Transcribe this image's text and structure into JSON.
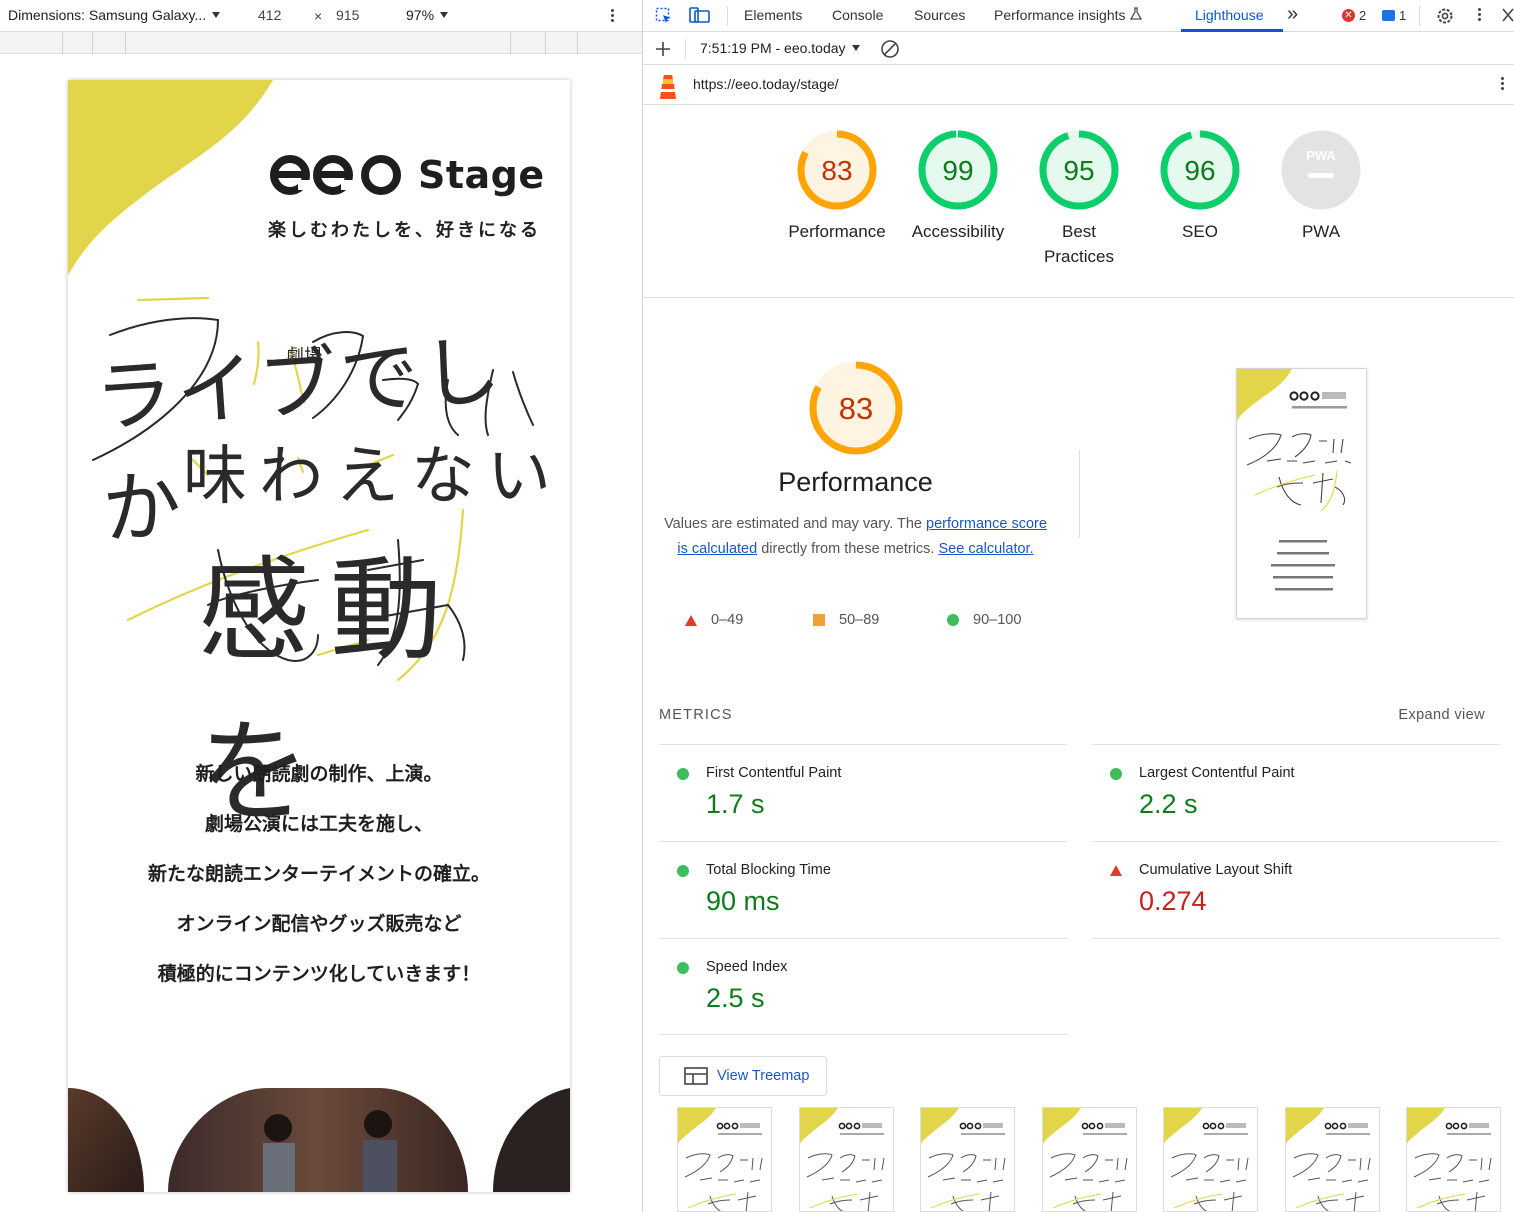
{
  "device_toolbar": {
    "dimensions_label": "Dimensions: Samsung Galaxy...",
    "width": "412",
    "times": "×",
    "height": "915",
    "zoom": "97%"
  },
  "phone_page": {
    "brand_logo": "eeo",
    "brand_stage": "Stage",
    "tagline": "楽しむわたしを、好きになる",
    "catch_line_1": "ライブでしか",
    "catch_line_1_small": "劇場",
    "catch_line_2": "味わえない",
    "catch_line_3": "感動を",
    "body_lines": [
      "新しい朗読劇の制作、上演。",
      "劇場公演には工夫を施し、",
      "新たな朗読エンターテイメントの確立。",
      "オンライン配信やグッズ販売など",
      "積極的にコンテンツ化していきます！"
    ]
  },
  "devtools": {
    "tabs": [
      "Elements",
      "Console",
      "Sources",
      "Performance insights",
      "Lighthouse"
    ],
    "more_tabs": "»",
    "errors_count": "2",
    "messages_count": "1",
    "report_time": "7:51:19 PM - eeo.today",
    "url": "https://eeo.today/stage/"
  },
  "scores": [
    {
      "label": "Performance",
      "value": "83",
      "score": 83,
      "tier": "average"
    },
    {
      "label": "Accessibility",
      "value": "99",
      "score": 99,
      "tier": "pass"
    },
    {
      "label": "Best\nPractices",
      "value": "95",
      "score": 95,
      "tier": "pass"
    },
    {
      "label": "SEO",
      "value": "96",
      "score": 96,
      "tier": "pass"
    },
    {
      "label": "PWA",
      "value": "",
      "score": 0,
      "tier": "na"
    }
  ],
  "pwa_badge_text": "PWA",
  "performance": {
    "score": "83",
    "score_num": 83,
    "title": "Performance",
    "desc_prefix": "Values are estimated and may vary. The ",
    "desc_link1": "performance score is calculated",
    "desc_mid": " directly from these metrics. ",
    "desc_link2": "See calculator.",
    "legend": [
      "0–49",
      "50–89",
      "90–100"
    ]
  },
  "metrics": {
    "header": "METRICS",
    "expand": "Expand view",
    "items": [
      {
        "name": "First Contentful Paint",
        "value": "1.7 s",
        "status": "pass"
      },
      {
        "name": "Largest Contentful Paint",
        "value": "2.2 s",
        "status": "pass"
      },
      {
        "name": "Total Blocking Time",
        "value": "90 ms",
        "status": "pass"
      },
      {
        "name": "Cumulative Layout Shift",
        "value": "0.274",
        "status": "fail"
      },
      {
        "name": "Speed Index",
        "value": "2.5 s",
        "status": "pass"
      }
    ]
  },
  "treemap_label": "View Treemap",
  "colors": {
    "pass": "#0c7d1a",
    "average": "#c33300",
    "fail": "#c5221f",
    "accent": "#0b57d0",
    "yellow": "#e3d54a"
  }
}
